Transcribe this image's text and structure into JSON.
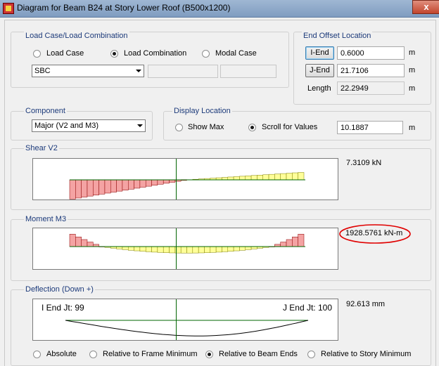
{
  "window": {
    "title": "Diagram for Beam B24 at Story Lower Roof (B500x1200)",
    "close_glyph": "x"
  },
  "load_case_group": {
    "title": "Load Case/Load Combination",
    "options": [
      {
        "label": "Load Case",
        "selected": false
      },
      {
        "label": "Load Combination",
        "selected": true
      },
      {
        "label": "Modal Case",
        "selected": false
      }
    ],
    "selected_combo": "SBC"
  },
  "end_offset_group": {
    "title": "End Offset Location",
    "i_end": {
      "button": "I-End",
      "value": "0.6000",
      "unit": "m"
    },
    "j_end": {
      "button": "J-End",
      "value": "21.7106",
      "unit": "m"
    },
    "length": {
      "label": "Length",
      "value": "22.2949",
      "unit": "m"
    }
  },
  "component_group": {
    "title": "Component",
    "selected": "Major (V2 and M3)"
  },
  "display_location_group": {
    "title": "Display Location",
    "options": [
      {
        "label": "Show Max",
        "selected": false
      },
      {
        "label": "Scroll for Values",
        "selected": true
      }
    ],
    "value": "10.1887",
    "unit": "m"
  },
  "shear": {
    "title": "Shear V2",
    "readout": "7.3109 kN",
    "cursor_fraction": 0.455
  },
  "moment": {
    "title": "Moment M3",
    "readout": "1928.5761 kN-m",
    "cursor_fraction": 0.455
  },
  "deflection": {
    "title": "Deflection (Down +)",
    "readout": "92.613 mm",
    "i_end_label": "I End Jt: 99",
    "j_end_label": "J End Jt: 100",
    "cursor_fraction": 0.455,
    "options": [
      {
        "label": "Absolute",
        "selected": false
      },
      {
        "label": "Relative to Frame Minimum",
        "selected": false
      },
      {
        "label": "Relative to Beam Ends",
        "selected": true
      },
      {
        "label": "Relative to Story Minimum",
        "selected": false
      }
    ]
  },
  "colors": {
    "negative_fill": "#f4a3a3",
    "positive_fill": "#ffff99",
    "outline": "#8b0000",
    "axis": "#006400",
    "highlight": "#e00000"
  }
}
